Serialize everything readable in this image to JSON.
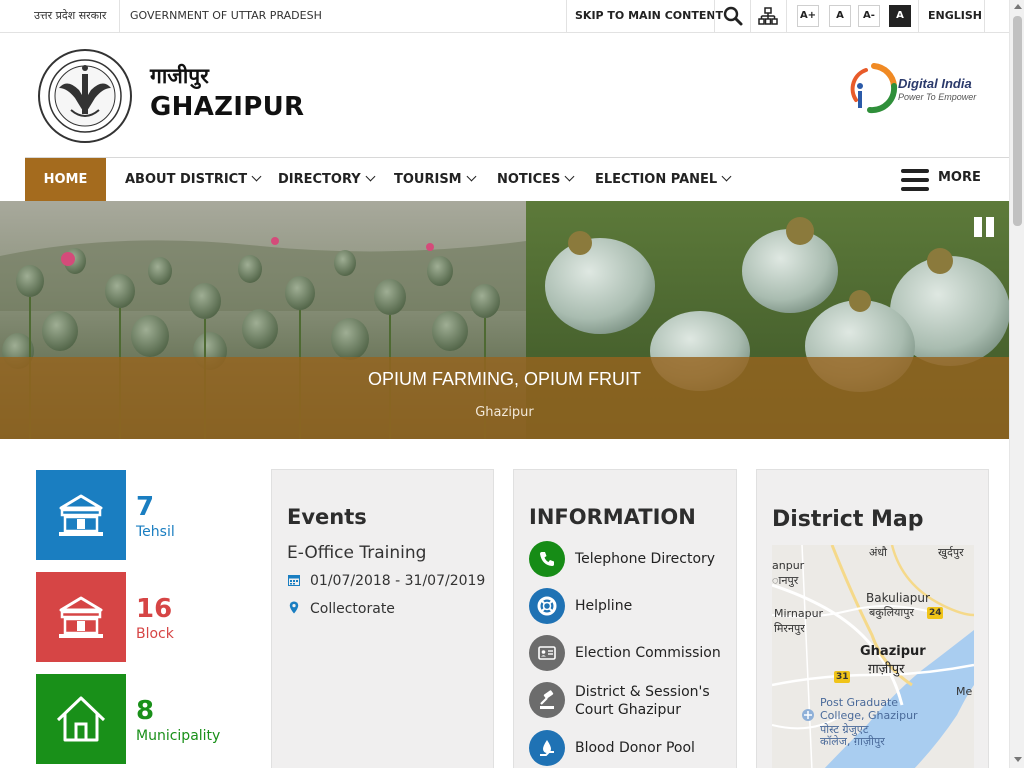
{
  "topbar": {
    "state_hi": "उत्तर प्रदेश सरकार",
    "state_en": "GOVERNMENT OF UTTAR PRADESH",
    "skip": "SKIP TO MAIN CONTENT",
    "font_larger": "A+",
    "font_normal": "A",
    "font_smaller": "A-",
    "contrast": "A",
    "language": "ENGLISH"
  },
  "header": {
    "name_hi": "गाजीपुर",
    "name_en": "GHAZIPUR",
    "digital_india_title": "Digital India",
    "digital_india_sub": "Power To Empower"
  },
  "nav": {
    "items": [
      "HOME",
      "ABOUT DISTRICT",
      "DIRECTORY",
      "TOURISM",
      "NOTICES",
      "ELECTION PANEL"
    ],
    "more": "MORE"
  },
  "banner": {
    "title": "OPIUM FARMING, OPIUM FRUIT",
    "subtitle": "Ghazipur"
  },
  "stats": [
    {
      "value": "7",
      "label": "Tehsil",
      "color": "#1a7ec1"
    },
    {
      "value": "16",
      "label": "Block",
      "color": "#d64545"
    },
    {
      "value": "8",
      "label": "Municipality",
      "color": "#199019"
    }
  ],
  "events": {
    "title": "Events",
    "name": "E-Office Training",
    "dates": "01/07/2018 - 31/07/2019",
    "location": "Collectorate"
  },
  "information": {
    "title": "INFORMATION",
    "items": [
      {
        "label": "Telephone Directory",
        "icon": "phone-icon",
        "color": "#168c16"
      },
      {
        "label": "Helpline",
        "icon": "lifebuoy-icon",
        "color": "#1f72b4"
      },
      {
        "label": "Election Commission",
        "icon": "id-card-icon",
        "color": "#6c6c6c"
      },
      {
        "label": "District & Session's Court Ghazipur",
        "icon": "gavel-icon",
        "color": "#6c6c6c"
      },
      {
        "label": "Blood Donor Pool",
        "icon": "blood-donation-icon",
        "color": "#1f72b4"
      }
    ]
  },
  "map": {
    "title": "District Map",
    "labels": {
      "andhau": "अंधौ",
      "khurdpur": "खुर्दपुर",
      "anpur_en": "anpur",
      "anpur_hi": "ानपुर",
      "mirnapur_en": "Mirnapur",
      "mirnapur_hi": "मिरनपुर",
      "bakuliapur_en": "Bakuliapur",
      "bakuliapur_hi": "बकुलियापुर",
      "ghazipur_en": "Ghazipur",
      "ghazipur_hi": "ग़ाज़ीपुर",
      "pg_college_1": "Post Graduate",
      "pg_college_2": "College, Ghazipur",
      "pg_college_3": "पोस्ट ग्रेजुएट",
      "pg_college_4": "कॉलेज, ग़ाज़ीपुर",
      "road_24": "24",
      "road_31": "31",
      "me": "Me"
    }
  }
}
